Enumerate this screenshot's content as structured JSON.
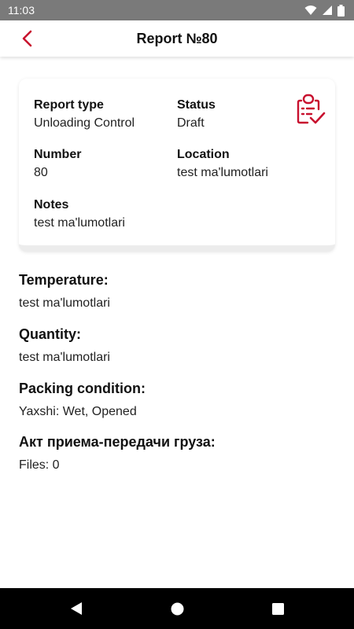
{
  "status_bar": {
    "time": "11:03"
  },
  "app_bar": {
    "title": "Report №80"
  },
  "card": {
    "report_type": {
      "label": "Report type",
      "value": "Unloading Control"
    },
    "status": {
      "label": "Status",
      "value": "Draft"
    },
    "number": {
      "label": "Number",
      "value": "80"
    },
    "location": {
      "label": "Location",
      "value": "test ma'lumotlari"
    },
    "notes": {
      "label": "Notes",
      "value": "test ma'lumotlari"
    },
    "icon": "clipboard-check-icon"
  },
  "sections": {
    "temperature": {
      "label": "Temperature:",
      "value": "test ma'lumotlari"
    },
    "quantity": {
      "label": "Quantity:",
      "value": "test ma'lumotlari"
    },
    "packing": {
      "label": "Packing condition:",
      "value": "Yaxshi: Wet, Opened"
    },
    "act": {
      "label": "Акт приема-передачи груза:",
      "value": "Files: 0"
    }
  },
  "colors": {
    "accent": "#c8102e",
    "status_bar": "#7a7a7a",
    "nav_bar": "#000000"
  }
}
